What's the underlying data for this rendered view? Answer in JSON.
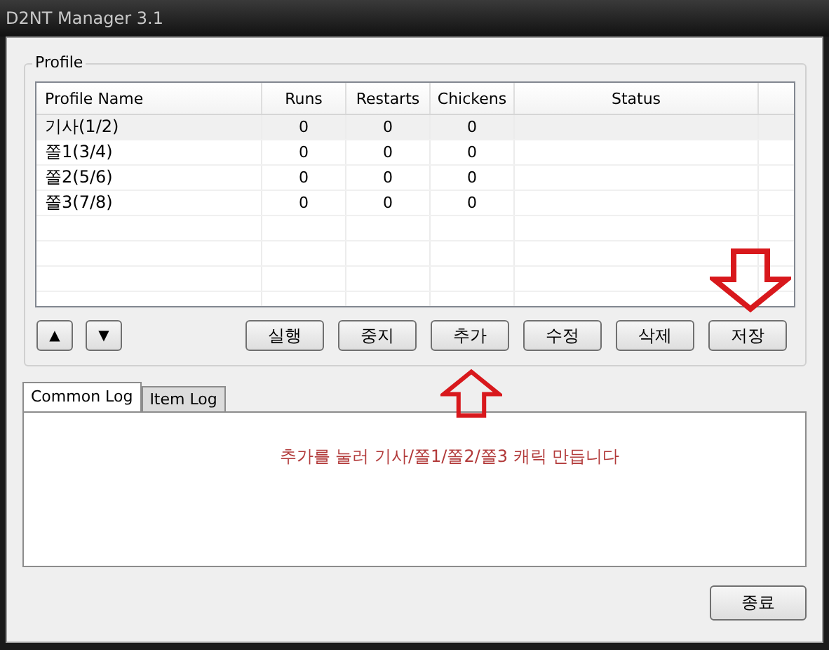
{
  "window": {
    "title": "D2NT Manager 3.1"
  },
  "profile": {
    "title": "Profile",
    "columns": [
      "Profile Name",
      "Runs",
      "Restarts",
      "Chickens",
      "Status"
    ],
    "rows": [
      {
        "cells": [
          "기사(1/2)",
          "0",
          "0",
          "0",
          ""
        ],
        "selected": true
      },
      {
        "cells": [
          "쫄1(3/4)",
          "0",
          "0",
          "0",
          ""
        ],
        "selected": false
      },
      {
        "cells": [
          "쫄2(5/6)",
          "0",
          "0",
          "0",
          ""
        ],
        "selected": false
      },
      {
        "cells": [
          "쫄3(7/8)",
          "0",
          "0",
          "0",
          ""
        ],
        "selected": false
      }
    ],
    "move_buttons": [
      "▲",
      "▼"
    ],
    "buttons": [
      "실행",
      "중지",
      "추가",
      "수정",
      "삭제",
      "저장"
    ]
  },
  "log_tabs": [
    {
      "label": "Common Log",
      "selected": true
    },
    {
      "label": "Item Log",
      "selected": false
    }
  ],
  "annotation": "추가를 눌러 기사/쫄1/쫄2/쫄3 캐릭 만듭니다",
  "close_button": "종료"
}
